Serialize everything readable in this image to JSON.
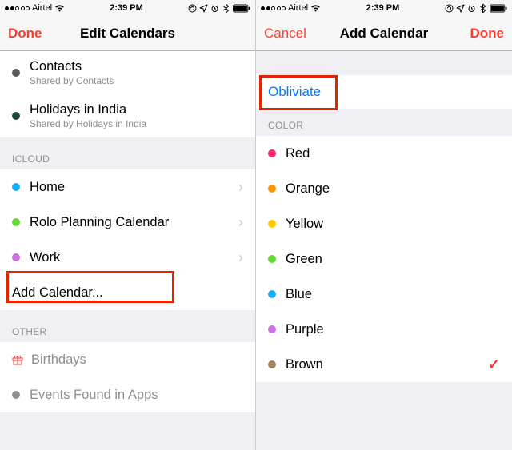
{
  "status_bar": {
    "carrier": "Airtel",
    "time": "2:39 PM"
  },
  "left": {
    "nav": {
      "left": "Done",
      "title": "Edit Calendars"
    },
    "subscribed": [
      {
        "label": "Contacts",
        "sub": "Shared by Contacts",
        "color": "#5b5b5e"
      },
      {
        "label": "Holidays in India",
        "sub": "Shared by Holidays in India",
        "color": "#1d493a"
      }
    ],
    "sections": {
      "icloud": {
        "header": "ICLOUD",
        "items": [
          {
            "label": "Home",
            "color": "#1badf8"
          },
          {
            "label": "Rolo Planning Calendar",
            "color": "#63da38"
          },
          {
            "label": "Work",
            "color": "#cc73e1"
          }
        ],
        "add": "Add Calendar..."
      },
      "other": {
        "header": "OTHER",
        "items": [
          {
            "label": "Birthdays",
            "icon": "gift",
            "dim": false
          },
          {
            "label": "Events Found in Apps",
            "color": "#8e8e93",
            "dim": true
          }
        ]
      }
    }
  },
  "right": {
    "nav": {
      "left": "Cancel",
      "title": "Add Calendar",
      "right": "Done"
    },
    "name_value": "Obliviate",
    "color_header": "COLOR",
    "colors": [
      {
        "label": "Red",
        "color": "#ff2968"
      },
      {
        "label": "Orange",
        "color": "#ff9500"
      },
      {
        "label": "Yellow",
        "color": "#ffcc00"
      },
      {
        "label": "Green",
        "color": "#63da38"
      },
      {
        "label": "Blue",
        "color": "#1badf8"
      },
      {
        "label": "Purple",
        "color": "#cc73e1"
      },
      {
        "label": "Brown",
        "color": "#a2845e",
        "selected": true
      }
    ]
  }
}
